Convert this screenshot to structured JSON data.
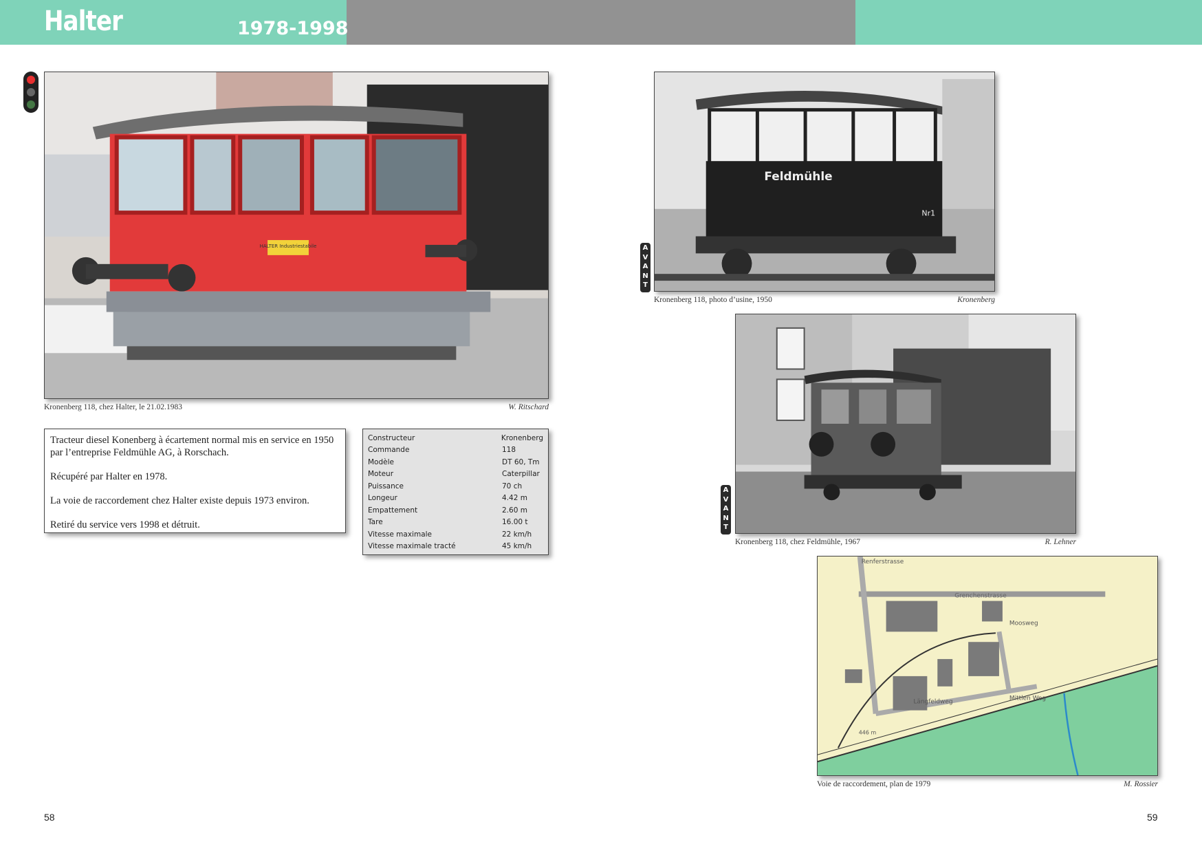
{
  "header": {
    "title": "Halter",
    "years": "1978-1998"
  },
  "photos": [
    {
      "caption": "Kronenberg 118, chez Halter, le 21.02.1983",
      "credit": "W. Ritschard",
      "sign_text": "HALTER Industriestabile"
    },
    {
      "caption": "Kronenberg 118, photo d’usine, 1950",
      "credit": "Kronenberg",
      "sign_text": "Feldmühle",
      "number": "Nr1"
    },
    {
      "caption": "Kronenberg 118, chez Feldmühle, 1967",
      "credit": "R. Lehner"
    },
    {
      "caption": "Voie de raccordement, plan de 1979",
      "credit": "M. Rossier",
      "map_labels": [
        "Grenchenstrasse",
        "Mittlen Weg",
        "Längfeldweg",
        "Moosweg",
        "Renferstrasse",
        "446 m"
      ]
    }
  ],
  "description": [
    "Tracteur diesel Konenberg à écartement normal mis en service en 1950 par l’entreprise Feldmühle AG, à Rorschach.",
    "Récupéré par Halter en 1978.",
    "La voie de raccordement chez Halter existe depuis 1973 environ.",
    "Retiré du service vers 1998 et détruit."
  ],
  "specs": [
    {
      "label": "Constructeur",
      "value": "Kronenberg"
    },
    {
      "label": "Commande",
      "value": "118"
    },
    {
      "label": "Modèle",
      "value": "DT 60, Tm"
    },
    {
      "label": "Moteur",
      "value": "Caterpillar"
    },
    {
      "label": "Puissance",
      "value": "70 ch"
    },
    {
      "label": "Longeur",
      "value": "4.42 m"
    },
    {
      "label": "Empattement",
      "value": "2.60 m"
    },
    {
      "label": "Tare",
      "value": "16.00 t"
    },
    {
      "label": "Vitesse maximale",
      "value": "22 km/h"
    },
    {
      "label": "Vitesse maximale tracté",
      "value": "45 km/h"
    }
  ],
  "avant_label": [
    "A",
    "V",
    "A",
    "N",
    "T"
  ],
  "page_numbers": {
    "left": "58",
    "right": "59"
  },
  "colors": {
    "header_green": "#7fd3b9",
    "header_gray": "#929292",
    "spec_bg": "#e3e3e3"
  }
}
